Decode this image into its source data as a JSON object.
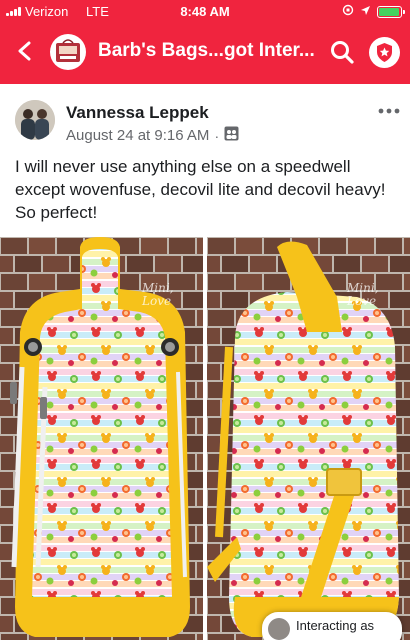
{
  "status_bar": {
    "carrier": "Verizon",
    "network": "LTE",
    "time": "8:48 AM",
    "battery_level_percent": 95,
    "battery_color": "#45d35f"
  },
  "nav": {
    "back_icon": "chevron-left-icon",
    "group_title": "Barb's Bags...got Inter...",
    "search_icon": "search-icon",
    "admin_icon": "shield-star-icon",
    "brand_color": "#f0243e"
  },
  "post": {
    "author": "Vannessa Leppek",
    "date": "August 24 at 9:16 AM",
    "separator": "·",
    "audience_icon": "group-audience-icon",
    "more_icon": "more-dots-icon",
    "text": "I will never use anything else on a speedwell except wovenfuse, decovil lite and decovil heavy! So perfect!"
  },
  "photos": {
    "count": 2,
    "watermark_left": "Mini, Love",
    "watermark_right": "Mini, Love"
  },
  "interacting_as": {
    "label": "Interacting as"
  }
}
